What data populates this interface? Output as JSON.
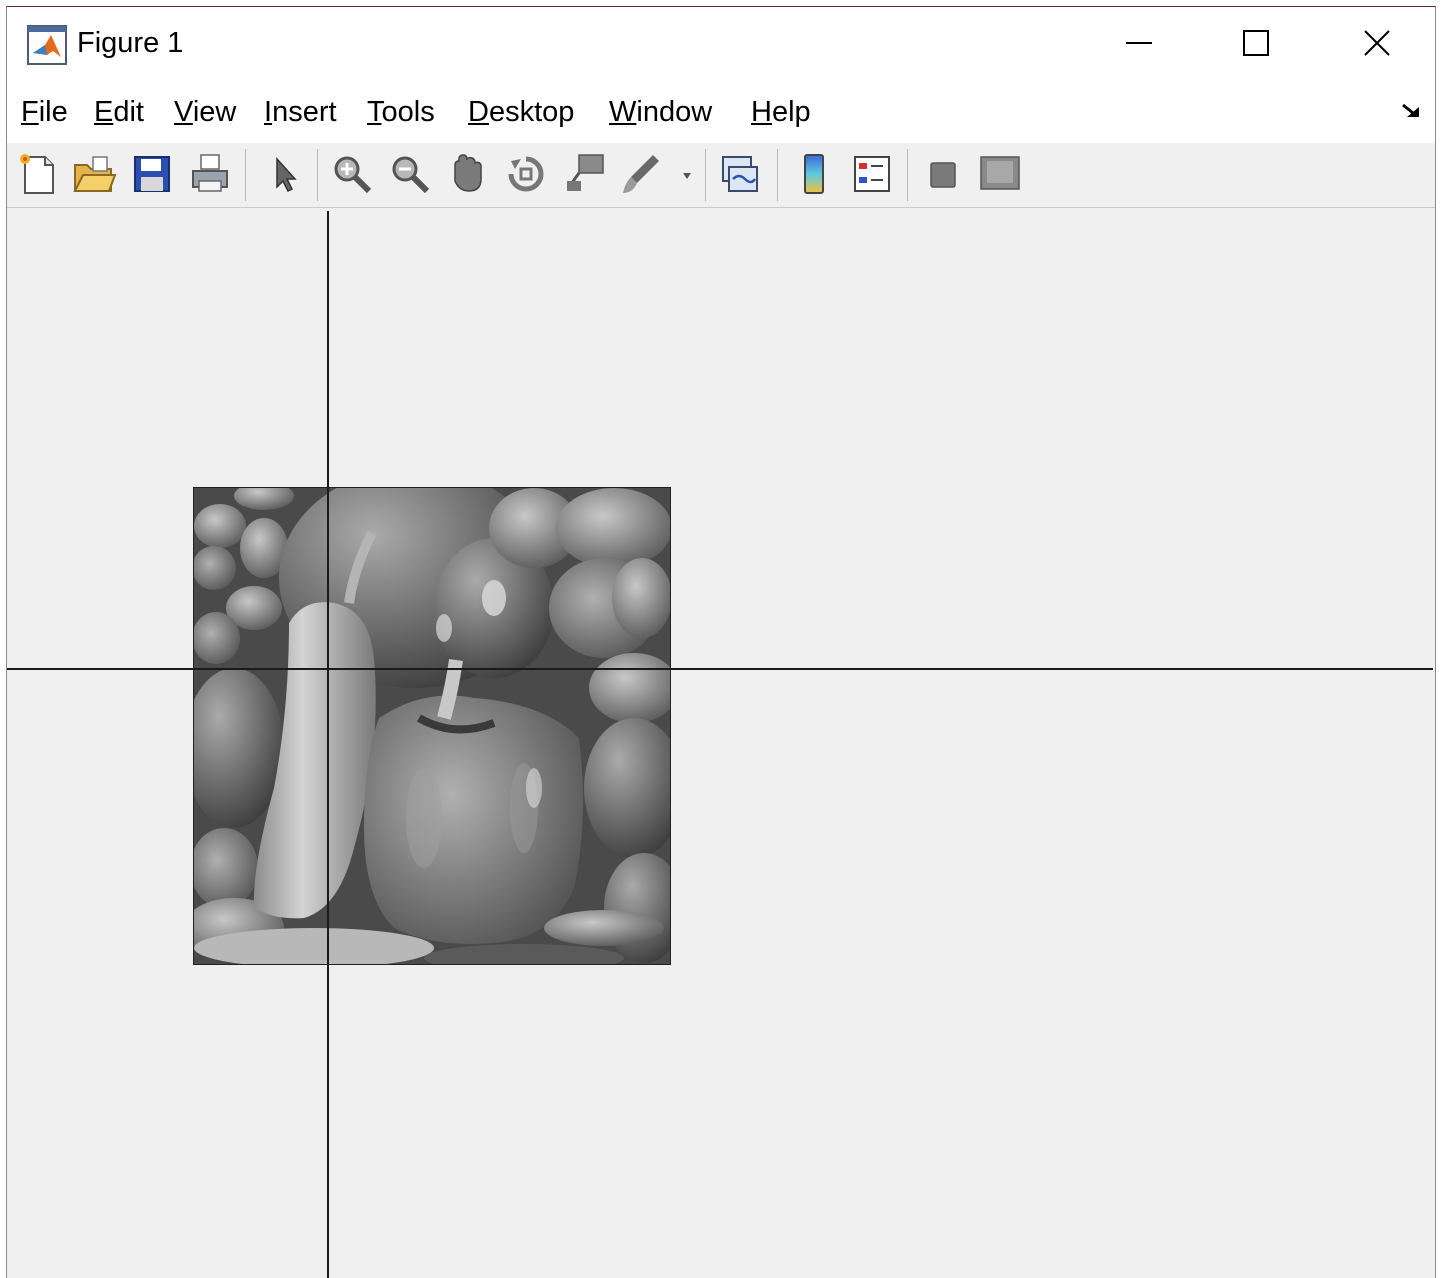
{
  "window": {
    "title": "Figure 1",
    "controls": [
      "minimize",
      "maximize",
      "close"
    ]
  },
  "menubar": {
    "items": [
      {
        "mnemonic": "F",
        "rest": "ile"
      },
      {
        "mnemonic": "E",
        "rest": "dit"
      },
      {
        "mnemonic": "V",
        "rest": "iew"
      },
      {
        "mnemonic": "I",
        "rest": "nsert"
      },
      {
        "mnemonic": "T",
        "rest": "ools"
      },
      {
        "mnemonic": "D",
        "rest": "esktop"
      },
      {
        "mnemonic": "W",
        "rest": "indow"
      },
      {
        "mnemonic": "H",
        "rest": "elp"
      }
    ]
  },
  "toolbar": {
    "buttons": [
      "new-figure",
      "open-file",
      "save",
      "print",
      "edit-plot",
      "zoom-in",
      "zoom-out",
      "pan",
      "rotate-3d",
      "data-cursor",
      "brush",
      "link-plot",
      "insert-colorbar",
      "insert-legend",
      "hide-plot-tools",
      "show-plot-tools"
    ]
  },
  "figure": {
    "image": "grayscale peppers",
    "crosshair": "crosshair cursor"
  },
  "colors": {
    "canvas": "#f0f0f0",
    "matlab_orange": "#e56a1c"
  }
}
